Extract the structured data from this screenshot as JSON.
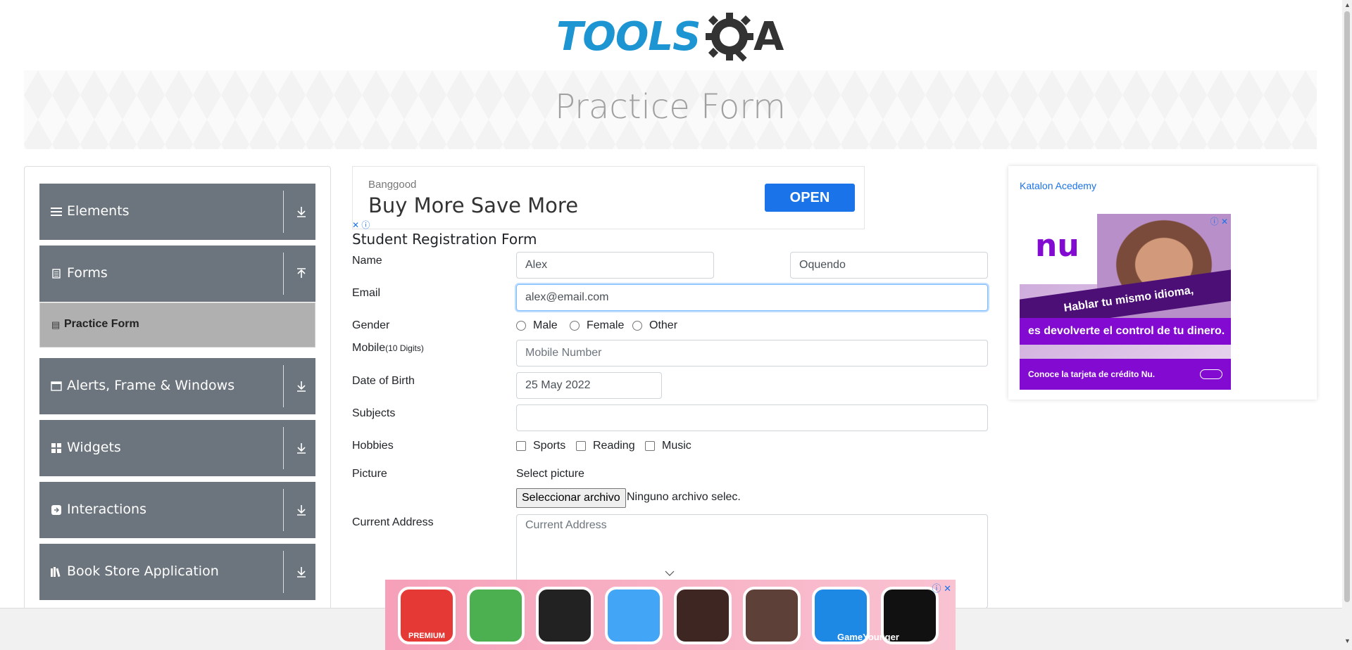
{
  "logo": {
    "text": "TOOLS",
    "tail": "A"
  },
  "banner": {
    "title": "Practice Form"
  },
  "sidebar": {
    "groups": [
      {
        "label": "Elements",
        "icon": "hamburger-icon"
      },
      {
        "label": "Forms",
        "icon": "document-icon",
        "expanded": true
      },
      {
        "label": "Alerts, Frame & Windows",
        "icon": "window-icon"
      },
      {
        "label": "Widgets",
        "icon": "grid-icon"
      },
      {
        "label": "Interactions",
        "icon": "interact-icon"
      },
      {
        "label": "Book Store Application",
        "icon": "book-icon"
      }
    ],
    "forms_sub": {
      "label": "Practice Form",
      "active": true
    }
  },
  "ad_top": {
    "brand": "Banggood",
    "headline": "Buy More Save More",
    "button": "OPEN",
    "close": "✕ ⓘ"
  },
  "form": {
    "title": "Student Registration Form",
    "name_label": "Name",
    "first_name": "Alex",
    "last_name": "Oquendo",
    "email_label": "Email",
    "email": "alex@email.com",
    "gender_label": "Gender",
    "genders": [
      "Male",
      "Female",
      "Other"
    ],
    "mobile_label": "Mobile",
    "mobile_hint": "(10 Digits)",
    "mobile_placeholder": "Mobile Number",
    "dob_label": "Date of Birth",
    "dob": "25 May 2022",
    "subjects_label": "Subjects",
    "hobbies_label": "Hobbies",
    "hobbies": [
      "Sports",
      "Reading",
      "Music"
    ],
    "picture_label": "Picture",
    "select_picture": "Select picture",
    "file_button": "Seleccionar archivo",
    "file_status": "Ninguno archivo selec.",
    "address_label": "Current Address",
    "address_placeholder": "Current Address"
  },
  "ad_right": {
    "link_text": "Katalon Acedemy",
    "nu_logo": "nu",
    "line1": "Hablar tu mismo idioma,",
    "line2": "es devolverte el control de tu dinero.",
    "line3": "Conoce la tarjeta de crédito Nu.",
    "close": "ⓘ ✕"
  },
  "game_ad": {
    "close": "ⓘ ✕",
    "brand": "GameYounger",
    "tile_colors": [
      "#e53935",
      "#4caf50",
      "#222222",
      "#42a5f5",
      "#3e2723",
      "#5d4037",
      "#1e88e5",
      "#111111"
    ],
    "tile_labels": [
      "PREMIUM",
      "",
      "",
      "",
      "",
      "",
      "",
      ""
    ]
  },
  "colors": {
    "sidebar_group": "#6c757d",
    "sidebar_active": "#b0b0b0",
    "logo_blue": "#1d95d2",
    "accent": "#1a73e8"
  }
}
